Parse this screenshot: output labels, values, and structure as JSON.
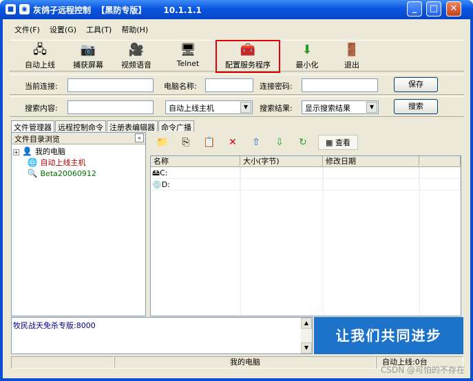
{
  "window": {
    "title": "灰鸽子远程控制  【黑防专版】      10.1.1.1",
    "colors": {
      "title_bar": "#0a4fd2",
      "highlight": "#e00000",
      "banner": "#1c73c9"
    }
  },
  "menu": [
    "文件(F)",
    "设置(G)",
    "工具(T)",
    "帮助(H)"
  ],
  "toolbar": [
    {
      "label": "自动上线",
      "icon": "network-icon"
    },
    {
      "label": "捕获屏幕",
      "icon": "camera-screen-icon"
    },
    {
      "label": "视频语音",
      "icon": "video-voice-icon"
    },
    {
      "label": "Telnet",
      "icon": "telnet-terminal-icon"
    },
    {
      "label": "配置服务程序",
      "icon": "config-service-icon"
    },
    {
      "label": "最小化",
      "icon": "minimize-arrow-icon"
    },
    {
      "label": "退出",
      "icon": "exit-door-icon"
    }
  ],
  "connection": {
    "current_label": "当前连接:",
    "current_value": "",
    "computer_name_label": "电脑名称:",
    "computer_name_value": "",
    "password_label": "连接密码:",
    "password_value": "",
    "save": "保存"
  },
  "search": {
    "content_label": "搜索内容:",
    "content_value": "",
    "scope": "自动上线主机",
    "result_label": "搜索结果:",
    "result_option": "显示搜索结果",
    "search_button": "搜索"
  },
  "tabs": [
    "文件管理器",
    "远程控制命令",
    "注册表编辑器",
    "命令广播"
  ],
  "tree": {
    "header": "文件目录浏览",
    "collapse": "«",
    "nodes": [
      {
        "label": "我的电脑",
        "expander": "+"
      },
      {
        "label": "自动上线主机"
      },
      {
        "label": "Beta20060912"
      }
    ]
  },
  "file_toolbar": {
    "view_label": "查看"
  },
  "file_list": {
    "columns": [
      "名称",
      "大小(字节)",
      "修改日期"
    ],
    "rows": [
      {
        "name": "C:"
      },
      {
        "name": "D:"
      }
    ]
  },
  "log": {
    "text": "牧民战天免杀专版:8000"
  },
  "banner": "让我们共同进步",
  "status": {
    "left": "",
    "center": "我的电脑",
    "right": "自动上线:0台"
  },
  "watermark": "CSDN @可怕的不存在"
}
